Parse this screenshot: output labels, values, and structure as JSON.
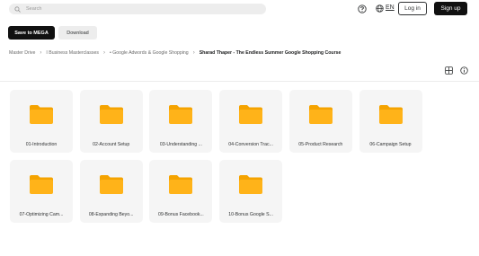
{
  "header": {
    "search_placeholder": "Search",
    "language": "EN",
    "login_label": "Log in",
    "signup_label": "Sign up"
  },
  "toolbar": {
    "save_label": "Save to MEGA",
    "download_label": "Download"
  },
  "breadcrumb": {
    "items": [
      "Master Drive",
      "I Business Masterclasses",
      "• Google Adwords & Google Shopping",
      "Sharad Thaper - The Endless Summer Google Shopping Course"
    ]
  },
  "folders": [
    {
      "name": "01-Introduction"
    },
    {
      "name": "02-Account Setup"
    },
    {
      "name": "03-Understanding ..."
    },
    {
      "name": "04-Conversion Trac..."
    },
    {
      "name": "05-Product Research"
    },
    {
      "name": "06-Campaign Setup"
    },
    {
      "name": "07-Optimizing Cam..."
    },
    {
      "name": "08-Expanding Beyo..."
    },
    {
      "name": "09-Bonus Facebook..."
    },
    {
      "name": "10-Bonus Google S..."
    }
  ],
  "colors": {
    "folder_yellow": "#FFB319",
    "folder_tab": "#F5A300",
    "button_dark": "#111111",
    "tile_bg": "#F5F5F5"
  },
  "icons": [
    "search-icon",
    "help-icon",
    "globe-icon",
    "grid-view-icon",
    "info-icon",
    "folder-icon"
  ]
}
